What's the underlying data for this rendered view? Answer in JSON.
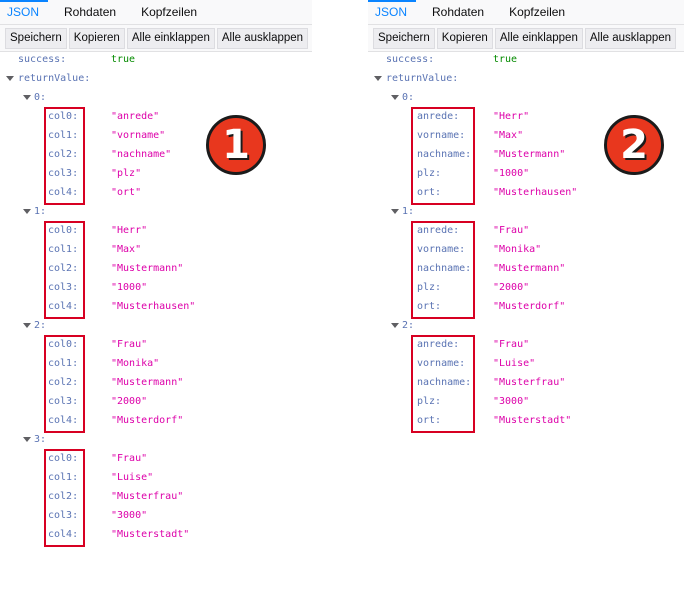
{
  "panels": [
    {
      "tabs": [
        "JSON",
        "Rohdaten",
        "Kopfzeilen"
      ],
      "active_tab": 0,
      "toolbar": [
        "Speichern",
        "Kopieren",
        "Alle einklappen",
        "Alle ausklappen"
      ],
      "success_key": "success:",
      "success_value": "true",
      "return_key": "returnValue:",
      "badge": "1",
      "items": [
        {
          "index": "0:",
          "rows": [
            [
              "col0:",
              "\"anrede\""
            ],
            [
              "col1:",
              "\"vorname\""
            ],
            [
              "col2:",
              "\"nachname\""
            ],
            [
              "col3:",
              "\"plz\""
            ],
            [
              "col4:",
              "\"ort\""
            ]
          ]
        },
        {
          "index": "1:",
          "rows": [
            [
              "col0:",
              "\"Herr\""
            ],
            [
              "col1:",
              "\"Max\""
            ],
            [
              "col2:",
              "\"Mustermann\""
            ],
            [
              "col3:",
              "\"1000\""
            ],
            [
              "col4:",
              "\"Musterhausen\""
            ]
          ]
        },
        {
          "index": "2:",
          "rows": [
            [
              "col0:",
              "\"Frau\""
            ],
            [
              "col1:",
              "\"Monika\""
            ],
            [
              "col2:",
              "\"Mustermann\""
            ],
            [
              "col3:",
              "\"2000\""
            ],
            [
              "col4:",
              "\"Musterdorf\""
            ]
          ]
        },
        {
          "index": "3:",
          "rows": [
            [
              "col0:",
              "\"Frau\""
            ],
            [
              "col1:",
              "\"Luise\""
            ],
            [
              "col2:",
              "\"Musterfrau\""
            ],
            [
              "col3:",
              "\"3000\""
            ],
            [
              "col4:",
              "\"Musterstadt\""
            ]
          ]
        }
      ]
    },
    {
      "tabs": [
        "JSON",
        "Rohdaten",
        "Kopfzeilen"
      ],
      "active_tab": 0,
      "toolbar": [
        "Speichern",
        "Kopieren",
        "Alle einklappen",
        "Alle ausklappen"
      ],
      "success_key": "success:",
      "success_value": "true",
      "return_key": "returnValue:",
      "badge": "2",
      "items": [
        {
          "index": "0:",
          "rows": [
            [
              "anrede:",
              "\"Herr\""
            ],
            [
              "vorname:",
              "\"Max\""
            ],
            [
              "nachname:",
              "\"Mustermann\""
            ],
            [
              "plz:",
              "\"1000\""
            ],
            [
              "ort:",
              "\"Musterhausen\""
            ]
          ]
        },
        {
          "index": "1:",
          "rows": [
            [
              "anrede:",
              "\"Frau\""
            ],
            [
              "vorname:",
              "\"Monika\""
            ],
            [
              "nachname:",
              "\"Mustermann\""
            ],
            [
              "plz:",
              "\"2000\""
            ],
            [
              "ort:",
              "\"Musterdorf\""
            ]
          ]
        },
        {
          "index": "2:",
          "rows": [
            [
              "anrede:",
              "\"Frau\""
            ],
            [
              "vorname:",
              "\"Luise\""
            ],
            [
              "nachname:",
              "\"Musterfrau\""
            ],
            [
              "plz:",
              "\"3000\""
            ],
            [
              "ort:",
              "\"Musterstadt\""
            ]
          ]
        }
      ]
    }
  ],
  "colors": {
    "accent": "#0a84ff",
    "key": "#5a73b3",
    "string": "#dd00a9",
    "boolean": "#058b00",
    "highlight_box": "#d70022",
    "badge": "#e8371e"
  }
}
